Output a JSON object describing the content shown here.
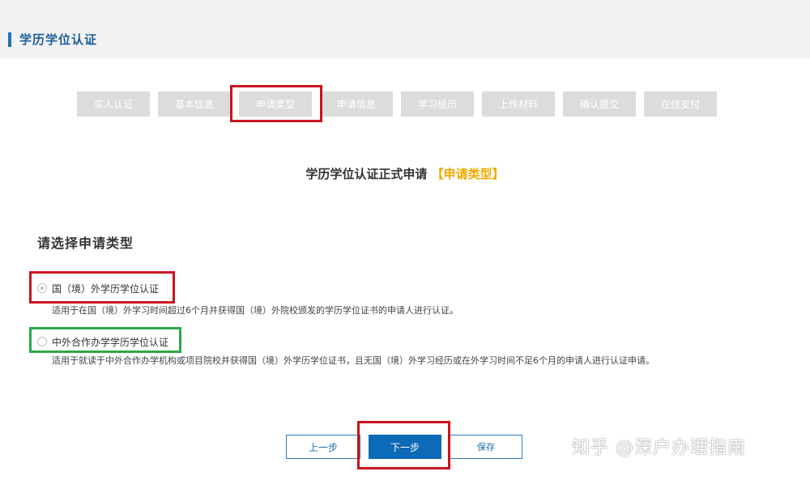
{
  "header": {
    "title": "学历学位认证"
  },
  "steps": [
    "实人认证",
    "基本信息",
    "申请类型",
    "申请信息",
    "学习经历",
    "上传材料",
    "确认提交",
    "在线支付"
  ],
  "active_step": "申请类型",
  "form": {
    "heading": "学历学位认证正式申请",
    "heading_tag": "【申请类型】",
    "select_label": "请选择申请类型"
  },
  "options": [
    {
      "label": "国（境）外学历学位认证",
      "description": "适用于在国（境）外学习时间超过6个月并获得国（境）外院校颁发的学历学位证书的申请人进行认证。"
    },
    {
      "label": "中外合作办学学历学位认证",
      "description": "适用于就读于中外合作办学机构或项目院校并获得国（境）外学历学位证书，且无国（境）外学习经历或在外学习时间不足6个月的申请人进行认证申请。"
    }
  ],
  "buttons": {
    "prev": "上一步",
    "next": "下一步",
    "save": "保存"
  },
  "watermark": "知乎 @深户办理指南",
  "colors": {
    "accent": "#1a73b5",
    "highlight_red": "#c8141e",
    "highlight_green": "#2aa84a",
    "tag": "#f0a800",
    "primary_button": "#0d6ab6"
  }
}
